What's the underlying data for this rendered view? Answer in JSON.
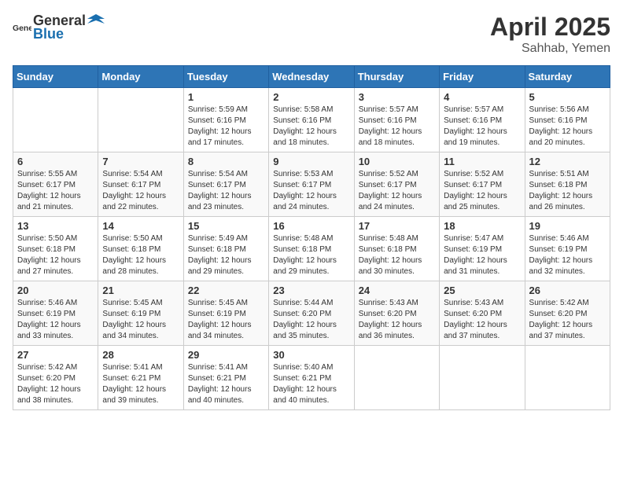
{
  "header": {
    "logo_general": "General",
    "logo_blue": "Blue",
    "title": "April 2025",
    "location": "Sahhab, Yemen"
  },
  "columns": [
    "Sunday",
    "Monday",
    "Tuesday",
    "Wednesday",
    "Thursday",
    "Friday",
    "Saturday"
  ],
  "weeks": [
    [
      {
        "day": "",
        "sunrise": "",
        "sunset": "",
        "daylight": ""
      },
      {
        "day": "",
        "sunrise": "",
        "sunset": "",
        "daylight": ""
      },
      {
        "day": "1",
        "sunrise": "Sunrise: 5:59 AM",
        "sunset": "Sunset: 6:16 PM",
        "daylight": "Daylight: 12 hours and 17 minutes."
      },
      {
        "day": "2",
        "sunrise": "Sunrise: 5:58 AM",
        "sunset": "Sunset: 6:16 PM",
        "daylight": "Daylight: 12 hours and 18 minutes."
      },
      {
        "day": "3",
        "sunrise": "Sunrise: 5:57 AM",
        "sunset": "Sunset: 6:16 PM",
        "daylight": "Daylight: 12 hours and 18 minutes."
      },
      {
        "day": "4",
        "sunrise": "Sunrise: 5:57 AM",
        "sunset": "Sunset: 6:16 PM",
        "daylight": "Daylight: 12 hours and 19 minutes."
      },
      {
        "day": "5",
        "sunrise": "Sunrise: 5:56 AM",
        "sunset": "Sunset: 6:16 PM",
        "daylight": "Daylight: 12 hours and 20 minutes."
      }
    ],
    [
      {
        "day": "6",
        "sunrise": "Sunrise: 5:55 AM",
        "sunset": "Sunset: 6:17 PM",
        "daylight": "Daylight: 12 hours and 21 minutes."
      },
      {
        "day": "7",
        "sunrise": "Sunrise: 5:54 AM",
        "sunset": "Sunset: 6:17 PM",
        "daylight": "Daylight: 12 hours and 22 minutes."
      },
      {
        "day": "8",
        "sunrise": "Sunrise: 5:54 AM",
        "sunset": "Sunset: 6:17 PM",
        "daylight": "Daylight: 12 hours and 23 minutes."
      },
      {
        "day": "9",
        "sunrise": "Sunrise: 5:53 AM",
        "sunset": "Sunset: 6:17 PM",
        "daylight": "Daylight: 12 hours and 24 minutes."
      },
      {
        "day": "10",
        "sunrise": "Sunrise: 5:52 AM",
        "sunset": "Sunset: 6:17 PM",
        "daylight": "Daylight: 12 hours and 24 minutes."
      },
      {
        "day": "11",
        "sunrise": "Sunrise: 5:52 AM",
        "sunset": "Sunset: 6:17 PM",
        "daylight": "Daylight: 12 hours and 25 minutes."
      },
      {
        "day": "12",
        "sunrise": "Sunrise: 5:51 AM",
        "sunset": "Sunset: 6:18 PM",
        "daylight": "Daylight: 12 hours and 26 minutes."
      }
    ],
    [
      {
        "day": "13",
        "sunrise": "Sunrise: 5:50 AM",
        "sunset": "Sunset: 6:18 PM",
        "daylight": "Daylight: 12 hours and 27 minutes."
      },
      {
        "day": "14",
        "sunrise": "Sunrise: 5:50 AM",
        "sunset": "Sunset: 6:18 PM",
        "daylight": "Daylight: 12 hours and 28 minutes."
      },
      {
        "day": "15",
        "sunrise": "Sunrise: 5:49 AM",
        "sunset": "Sunset: 6:18 PM",
        "daylight": "Daylight: 12 hours and 29 minutes."
      },
      {
        "day": "16",
        "sunrise": "Sunrise: 5:48 AM",
        "sunset": "Sunset: 6:18 PM",
        "daylight": "Daylight: 12 hours and 29 minutes."
      },
      {
        "day": "17",
        "sunrise": "Sunrise: 5:48 AM",
        "sunset": "Sunset: 6:18 PM",
        "daylight": "Daylight: 12 hours and 30 minutes."
      },
      {
        "day": "18",
        "sunrise": "Sunrise: 5:47 AM",
        "sunset": "Sunset: 6:19 PM",
        "daylight": "Daylight: 12 hours and 31 minutes."
      },
      {
        "day": "19",
        "sunrise": "Sunrise: 5:46 AM",
        "sunset": "Sunset: 6:19 PM",
        "daylight": "Daylight: 12 hours and 32 minutes."
      }
    ],
    [
      {
        "day": "20",
        "sunrise": "Sunrise: 5:46 AM",
        "sunset": "Sunset: 6:19 PM",
        "daylight": "Daylight: 12 hours and 33 minutes."
      },
      {
        "day": "21",
        "sunrise": "Sunrise: 5:45 AM",
        "sunset": "Sunset: 6:19 PM",
        "daylight": "Daylight: 12 hours and 34 minutes."
      },
      {
        "day": "22",
        "sunrise": "Sunrise: 5:45 AM",
        "sunset": "Sunset: 6:19 PM",
        "daylight": "Daylight: 12 hours and 34 minutes."
      },
      {
        "day": "23",
        "sunrise": "Sunrise: 5:44 AM",
        "sunset": "Sunset: 6:20 PM",
        "daylight": "Daylight: 12 hours and 35 minutes."
      },
      {
        "day": "24",
        "sunrise": "Sunrise: 5:43 AM",
        "sunset": "Sunset: 6:20 PM",
        "daylight": "Daylight: 12 hours and 36 minutes."
      },
      {
        "day": "25",
        "sunrise": "Sunrise: 5:43 AM",
        "sunset": "Sunset: 6:20 PM",
        "daylight": "Daylight: 12 hours and 37 minutes."
      },
      {
        "day": "26",
        "sunrise": "Sunrise: 5:42 AM",
        "sunset": "Sunset: 6:20 PM",
        "daylight": "Daylight: 12 hours and 37 minutes."
      }
    ],
    [
      {
        "day": "27",
        "sunrise": "Sunrise: 5:42 AM",
        "sunset": "Sunset: 6:20 PM",
        "daylight": "Daylight: 12 hours and 38 minutes."
      },
      {
        "day": "28",
        "sunrise": "Sunrise: 5:41 AM",
        "sunset": "Sunset: 6:21 PM",
        "daylight": "Daylight: 12 hours and 39 minutes."
      },
      {
        "day": "29",
        "sunrise": "Sunrise: 5:41 AM",
        "sunset": "Sunset: 6:21 PM",
        "daylight": "Daylight: 12 hours and 40 minutes."
      },
      {
        "day": "30",
        "sunrise": "Sunrise: 5:40 AM",
        "sunset": "Sunset: 6:21 PM",
        "daylight": "Daylight: 12 hours and 40 minutes."
      },
      {
        "day": "",
        "sunrise": "",
        "sunset": "",
        "daylight": ""
      },
      {
        "day": "",
        "sunrise": "",
        "sunset": "",
        "daylight": ""
      },
      {
        "day": "",
        "sunrise": "",
        "sunset": "",
        "daylight": ""
      }
    ]
  ]
}
